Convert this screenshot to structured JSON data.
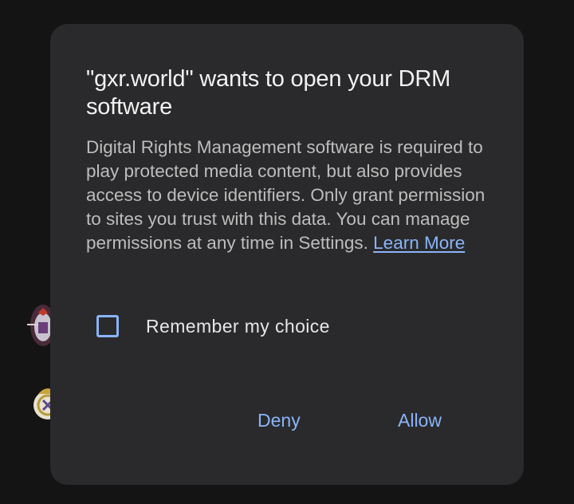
{
  "dialog": {
    "title": "\"gxr.world\" wants to open your DRM software",
    "body": "Digital Rights Management software is required to play protected media content, but also provides access to device identifiers. Only grant permission to sites you trust with this data. You can manage permissions at any time in Settings.",
    "learn_more": "Learn More",
    "remember_label": "Remember my choice",
    "remember_checked": false,
    "deny_label": "Deny",
    "allow_label": "Allow"
  },
  "colors": {
    "page_background": "#141414",
    "dialog_background": "#2a2a2c",
    "accent": "#8ab4f8",
    "title_text": "#f2f2f2",
    "body_text": "#bdbdbd"
  },
  "background_icons": [
    "club-crest-icon",
    "club-crest-icon"
  ]
}
